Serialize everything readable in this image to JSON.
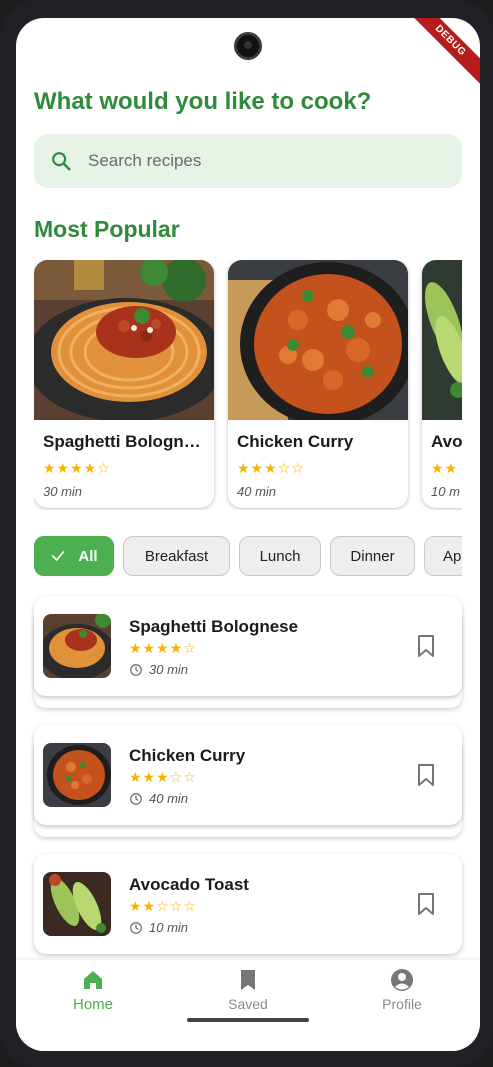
{
  "debug_banner": "DEBUG",
  "heading": "What would you like to cook?",
  "search": {
    "placeholder": "Search recipes",
    "value": ""
  },
  "popular": {
    "title": "Most Popular",
    "items": [
      {
        "name": "Spaghetti Bolognese",
        "display_name": "Spaghetti Bologne…",
        "stars": "★★★★☆",
        "rating": 4,
        "time": "30 min"
      },
      {
        "name": "Chicken Curry",
        "display_name": "Chicken Curry",
        "stars": "★★★☆☆",
        "rating": 3,
        "time": "40 min"
      },
      {
        "name": "Avocado Toast",
        "display_name": "Avo",
        "stars": "★★",
        "rating": 2,
        "time": "10 m"
      }
    ]
  },
  "filters": {
    "selected": "All",
    "items": [
      "All",
      "Breakfast",
      "Lunch",
      "Dinner",
      "Ap"
    ]
  },
  "recipes": [
    {
      "name": "Spaghetti Bolognese",
      "stars": "★★★★☆",
      "rating": 4,
      "time": "30 min"
    },
    {
      "name": "Chicken Curry",
      "stars": "★★★☆☆",
      "rating": 3,
      "time": "40 min"
    },
    {
      "name": "Avocado Toast",
      "stars": "★★☆☆☆",
      "rating": 2,
      "time": "10 min"
    }
  ],
  "nav": {
    "items": [
      {
        "label": "Home",
        "icon": "home-icon",
        "active": true
      },
      {
        "label": "Saved",
        "icon": "bookmark-icon",
        "active": false
      },
      {
        "label": "Profile",
        "icon": "account-circle-icon",
        "active": false
      }
    ]
  },
  "colors": {
    "primary_green": "#2e8b3a",
    "accent_green": "#4caf50",
    "search_bg": "#e6f3e6",
    "star": "#f4b400"
  }
}
